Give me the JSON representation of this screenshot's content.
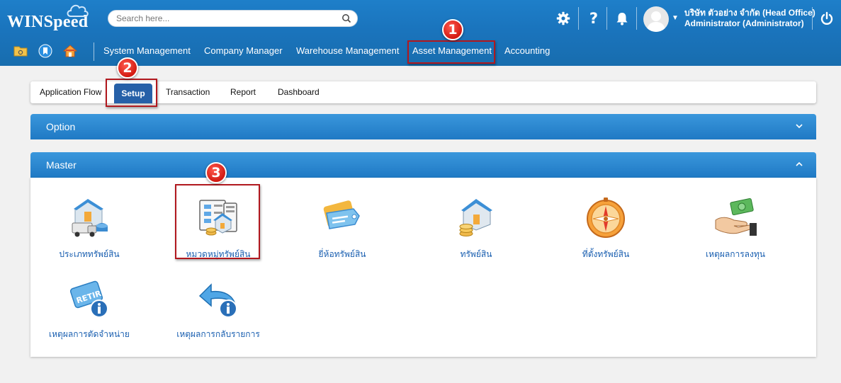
{
  "app": {
    "logo": "WINSpeed"
  },
  "search": {
    "placeholder": "Search here..."
  },
  "header": {
    "company": "บริษัท ตัวอย่าง จำกัด (Head Office)",
    "user": "Administrator (Administrator)"
  },
  "nav": {
    "items": [
      "System Management",
      "Company Manager",
      "Warehouse Management",
      "Asset Management",
      "Accounting"
    ]
  },
  "tabs": [
    "Application Flow",
    "Setup",
    "Transaction",
    "Report",
    "Dashboard"
  ],
  "panels": {
    "option": "Option",
    "master": "Master"
  },
  "master_items": [
    "ประเภททรัพย์สิน",
    "หมวดหมู่ทรัพย์สิน",
    "ยี่ห้อทรัพย์สิน",
    "ทรัพย์สิน",
    "ที่ตั้งทรัพย์สิน",
    "เหตุผลการลงทุน",
    "เหตุผลการตัดจำหน่าย",
    "เหตุผลการกลับรายการ"
  ],
  "callouts": [
    "1",
    "2",
    "3"
  ],
  "icons": {
    "retire_label": "RETIRE"
  },
  "colors": {
    "header": "#1e7fc9",
    "active_tab": "#2660a8",
    "highlight": "#b1181e",
    "link": "#1a5fb0"
  }
}
